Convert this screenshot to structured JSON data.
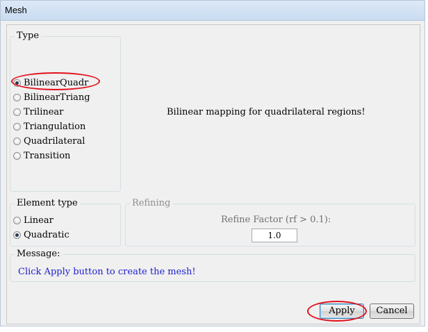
{
  "window": {
    "title": "Mesh"
  },
  "type_group": {
    "legend": "Type",
    "options": [
      {
        "label": "BilinearQuadr",
        "checked": true
      },
      {
        "label": "BilinearTriang",
        "checked": false
      },
      {
        "label": "Trilinear",
        "checked": false
      },
      {
        "label": "Triangulation",
        "checked": false
      },
      {
        "label": "Quadrilateral",
        "checked": false
      },
      {
        "label": "Transition",
        "checked": false
      }
    ],
    "description": "Bilinear mapping for quadrilateral regions!"
  },
  "element_type_group": {
    "legend": "Element type",
    "options": [
      {
        "label": "Linear",
        "checked": false
      },
      {
        "label": "Quadratic",
        "checked": true
      }
    ]
  },
  "refining_group": {
    "legend": "Refining",
    "refine_label": "Refine Factor (rf > 0.1):",
    "refine_value": "1.0"
  },
  "message_group": {
    "legend": "Message:",
    "text": "Click Apply button to create the mesh!"
  },
  "buttons": {
    "apply": "Apply",
    "cancel": "Cancel"
  },
  "colors": {
    "annotation": "#e3101b",
    "message_text": "#1d1dcc"
  }
}
